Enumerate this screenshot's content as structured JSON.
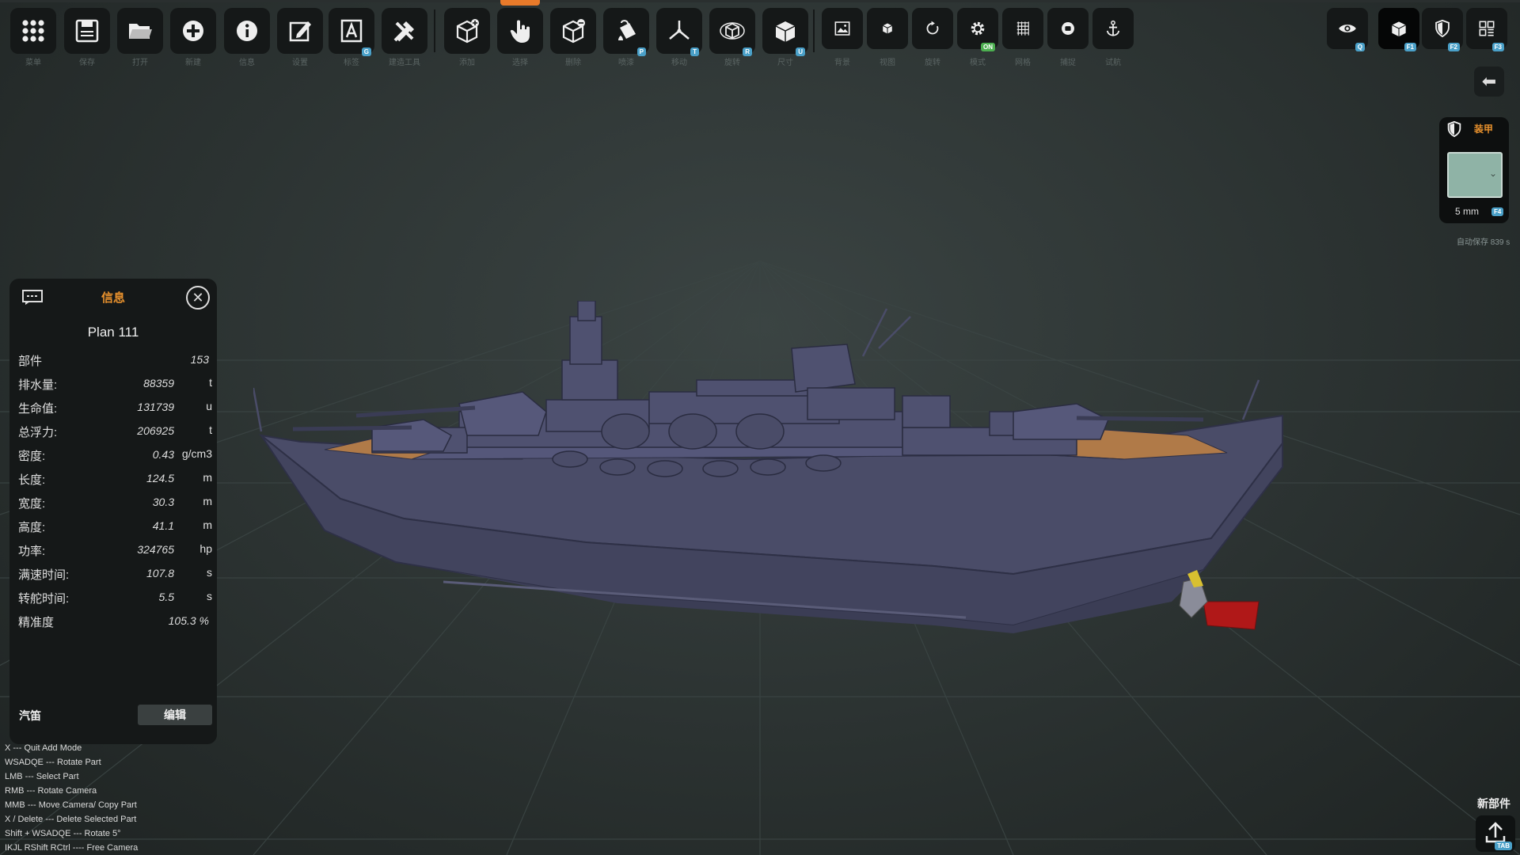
{
  "toolbar": {
    "tools": [
      {
        "name": "grid-menu-icon",
        "label": "菜单",
        "badge": ""
      },
      {
        "name": "save-icon",
        "label": "保存",
        "badge": ""
      },
      {
        "name": "open-folder-icon",
        "label": "打开",
        "badge": ""
      },
      {
        "name": "add-circle-icon",
        "label": "新建",
        "badge": ""
      },
      {
        "name": "info-icon",
        "label": "信息",
        "badge": ""
      },
      {
        "name": "edit-icon",
        "label": "设置",
        "badge": ""
      },
      {
        "name": "text-icon",
        "label": "标签",
        "badge": "G"
      },
      {
        "name": "tools-icon",
        "label": "建造工具",
        "badge": ""
      },
      {
        "name": "add-box-icon",
        "label": "添加",
        "badge": ""
      },
      {
        "name": "hand-pointer-icon",
        "label": "选择",
        "badge": ""
      },
      {
        "name": "remove-box-icon",
        "label": "删除",
        "badge": ""
      },
      {
        "name": "paint-bucket-icon",
        "label": "喷漆",
        "badge": "P"
      },
      {
        "name": "move-axes-icon",
        "label": "移动",
        "badge": "T"
      },
      {
        "name": "rotate-box-icon",
        "label": "旋转",
        "badge": "R"
      },
      {
        "name": "scale-box-icon",
        "label": "尺寸",
        "badge": "U"
      },
      {
        "name": "image-icon",
        "label": "背景",
        "badge": ""
      },
      {
        "name": "small-box-icon",
        "label": "视图",
        "badge": ""
      },
      {
        "name": "refresh-icon",
        "label": "旋转",
        "badge": ""
      },
      {
        "name": "settings-gear-icon",
        "label": "模式",
        "badge": "ON"
      },
      {
        "name": "grid-lines-icon",
        "label": "网格",
        "badge": ""
      },
      {
        "name": "stop-circle-icon",
        "label": "捕捉",
        "badge": ""
      },
      {
        "name": "anchor-icon",
        "label": "试航",
        "badge": ""
      }
    ],
    "right_tools": [
      {
        "name": "eye-icon",
        "badge": "Q"
      },
      {
        "name": "cube-view-icon",
        "badge": "F1"
      },
      {
        "name": "armor-shield-icon",
        "badge": "F2"
      },
      {
        "name": "layout-grid-icon",
        "badge": "F3"
      }
    ]
  },
  "armor": {
    "title": "装甲",
    "thickness": "5 mm",
    "hotkey": "F4",
    "swatch_color": "#8fb3a6"
  },
  "autosave": "自动保存 839 s",
  "info": {
    "tab": "信息",
    "ship_name": "Plan 111",
    "stats": [
      {
        "label": "部件",
        "value": "153",
        "unit": ""
      },
      {
        "label": "排水量:",
        "value": "88359",
        "unit": "t"
      },
      {
        "label": "生命值:",
        "value": "131739",
        "unit": "u"
      },
      {
        "label": "总浮力:",
        "value": "206925",
        "unit": "t"
      },
      {
        "label": "密度:",
        "value": "0.43",
        "unit": "g/cm3"
      },
      {
        "label": "长度:",
        "value": "124.5",
        "unit": "m"
      },
      {
        "label": "宽度:",
        "value": "30.3",
        "unit": "m"
      },
      {
        "label": "高度:",
        "value": "41.1",
        "unit": "m"
      },
      {
        "label": "功率:",
        "value": "324765",
        "unit": "hp"
      },
      {
        "label": "满速时间:",
        "value": "107.8",
        "unit": "s"
      },
      {
        "label": "转舵时间:",
        "value": "5.5",
        "unit": "s"
      },
      {
        "label": "精准度",
        "value": "105.3 %",
        "unit": ""
      }
    ],
    "horn_label": "汽笛",
    "edit_label": "编辑"
  },
  "help_lines": [
    "X --- Quit Add Mode",
    "WSADQE --- Rotate Part",
    "LMB --- Select Part",
    "RMB --- Rotate Camera",
    "MMB --- Move Camera/ Copy Part",
    "X / Delete --- Delete Selected Part",
    "Shift + WSADQE --- Rotate 5°",
    "IKJL RShift RCtrl ---- Free Camera"
  ],
  "new_part": {
    "label": "新部件",
    "hotkey": "TAB"
  },
  "colors": {
    "accent": "#e87a2a",
    "badge": "#4aa0c8",
    "hull": "#4a4c68",
    "deck": "#b07a48",
    "rudder": "#b01818"
  }
}
